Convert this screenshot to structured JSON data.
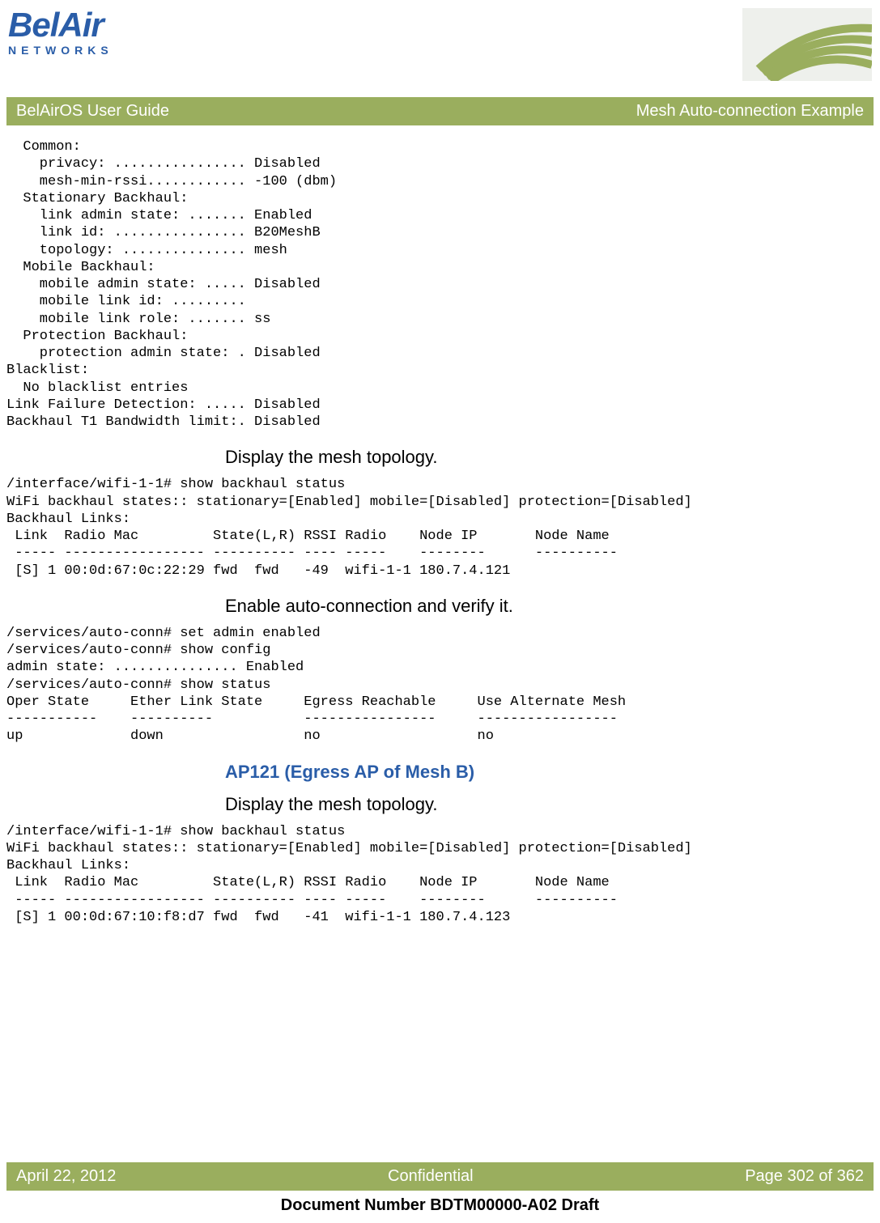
{
  "header": {
    "logo_top": "BelAir",
    "logo_bottom": "NETWORKS",
    "guide_title": "BelAirOS User Guide",
    "section_title": "Mesh Auto-connection Example"
  },
  "blocks": {
    "config": "  Common:\n    privacy: ................ Disabled\n    mesh-min-rssi............ -100 (dbm)\n  Stationary Backhaul:\n    link admin state: ....... Enabled\n    link id: ................ B20MeshB\n    topology: ............... mesh\n  Mobile Backhaul:\n    mobile admin state: ..... Disabled\n    mobile link id: .........\n    mobile link role: ....... ss\n  Protection Backhaul:\n    protection admin state: . Disabled\nBlacklist:\n  No blacklist entries\nLink Failure Detection: ..... Disabled\nBackhaul T1 Bandwidth limit:. Disabled",
    "heading1": "Display the mesh topology.",
    "topology1": "/interface/wifi-1-1# show backhaul status\nWiFi backhaul states:: stationary=[Enabled] mobile=[Disabled] protection=[Disabled]\nBackhaul Links:\n Link  Radio Mac         State(L,R) RSSI Radio    Node IP       Node Name\n ----- ----------------- ---------- ---- -----    --------      ----------\n [S] 1 00:0d:67:0c:22:29 fwd  fwd   -49  wifi-1-1 180.7.4.121",
    "heading2": "Enable auto-connection and verify it.",
    "autoconn": "/services/auto-conn# set admin enabled\n/services/auto-conn# show config\nadmin state: ............... Enabled\n/services/auto-conn# show status\nOper State     Ether Link State     Egress Reachable     Use Alternate Mesh\n-----------    ----------           ----------------     -----------------\nup             down                 no                   no",
    "heading3": "AP121 (Egress AP of Mesh B)",
    "heading4": "Display the mesh topology.",
    "topology2": "/interface/wifi-1-1# show backhaul status\nWiFi backhaul states:: stationary=[Enabled] mobile=[Disabled] protection=[Disabled]\nBackhaul Links:\n Link  Radio Mac         State(L,R) RSSI Radio    Node IP       Node Name\n ----- ----------------- ---------- ---- -----    --------      ----------\n [S] 1 00:0d:67:10:f8:d7 fwd  fwd   -41  wifi-1-1 180.7.4.123"
  },
  "footer": {
    "date": "April 22, 2012",
    "confidentiality": "Confidential",
    "page": "Page 302 of 362",
    "doc_number": "Document Number BDTM00000-A02 Draft"
  }
}
